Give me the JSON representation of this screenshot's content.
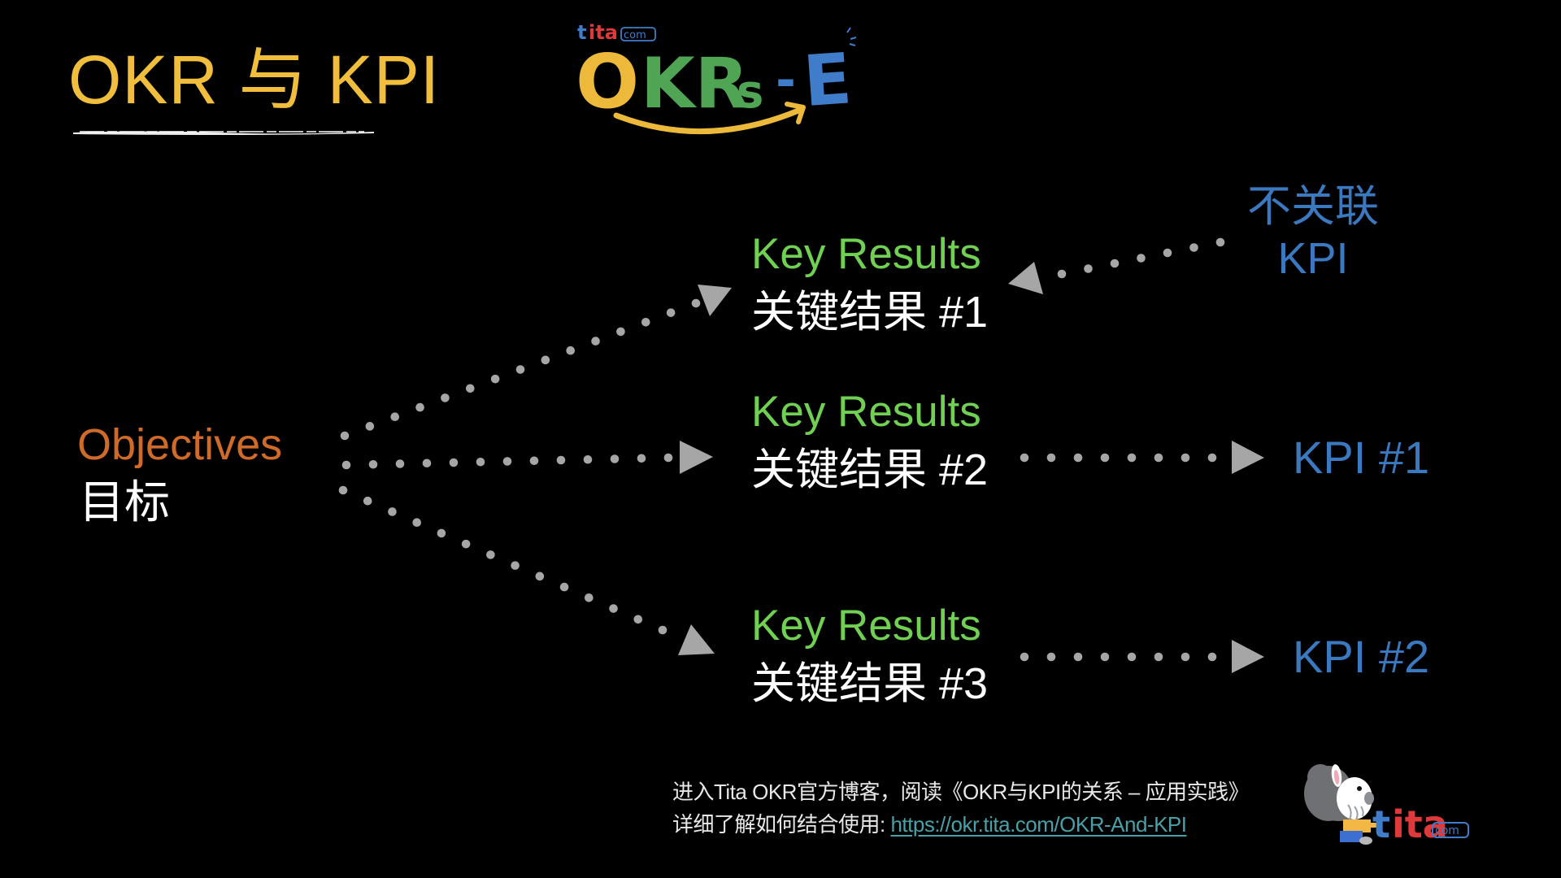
{
  "slide": {
    "title": "OKR 与 KPI",
    "brand_logo": {
      "small_text": "tita",
      "small_suffix": ".com",
      "main_text_parts": [
        "O",
        "K",
        "R",
        "s",
        "-",
        "E"
      ],
      "colors": {
        "o": "#EDB93A",
        "krs": "#4FA554",
        "e": "#3F7DCB",
        "tita_t": "#3F7DCB",
        "tita_ita": "#E0393B",
        "arrow": "#EDB93A"
      }
    },
    "objectives": {
      "label_en": "Objectives",
      "label_zh": "目标",
      "color": "#D06A28"
    },
    "key_results": [
      {
        "label_en": "Key Results",
        "label_zh": "关键结果 #1"
      },
      {
        "label_en": "Key Results",
        "label_zh": "关键结果 #2"
      },
      {
        "label_en": "Key Results",
        "label_zh": "关键结果 #3"
      }
    ],
    "unrelated_kpi": {
      "line1": "不关联",
      "line2": "KPI"
    },
    "kpis": [
      {
        "label": "KPI #1"
      },
      {
        "label": "KPI #2"
      }
    ],
    "colors": {
      "title": "#F0BE3C",
      "key_results": "#6FD052",
      "kpi": "#3A78C0",
      "connector": "#A6A6A6",
      "background": "#000000"
    },
    "footer": {
      "line1": "进入Tita OKR官方博客，阅读《OKR与KPI的关系 – 应用实践》",
      "line2_prefix": "详细了解如何结合使用: ",
      "link_text": "https://okr.tita.com/OKR-And-KPI"
    },
    "corner_logo": {
      "text": "tita",
      "suffix": ".com",
      "icon": "zebra-mascot-icon"
    }
  }
}
